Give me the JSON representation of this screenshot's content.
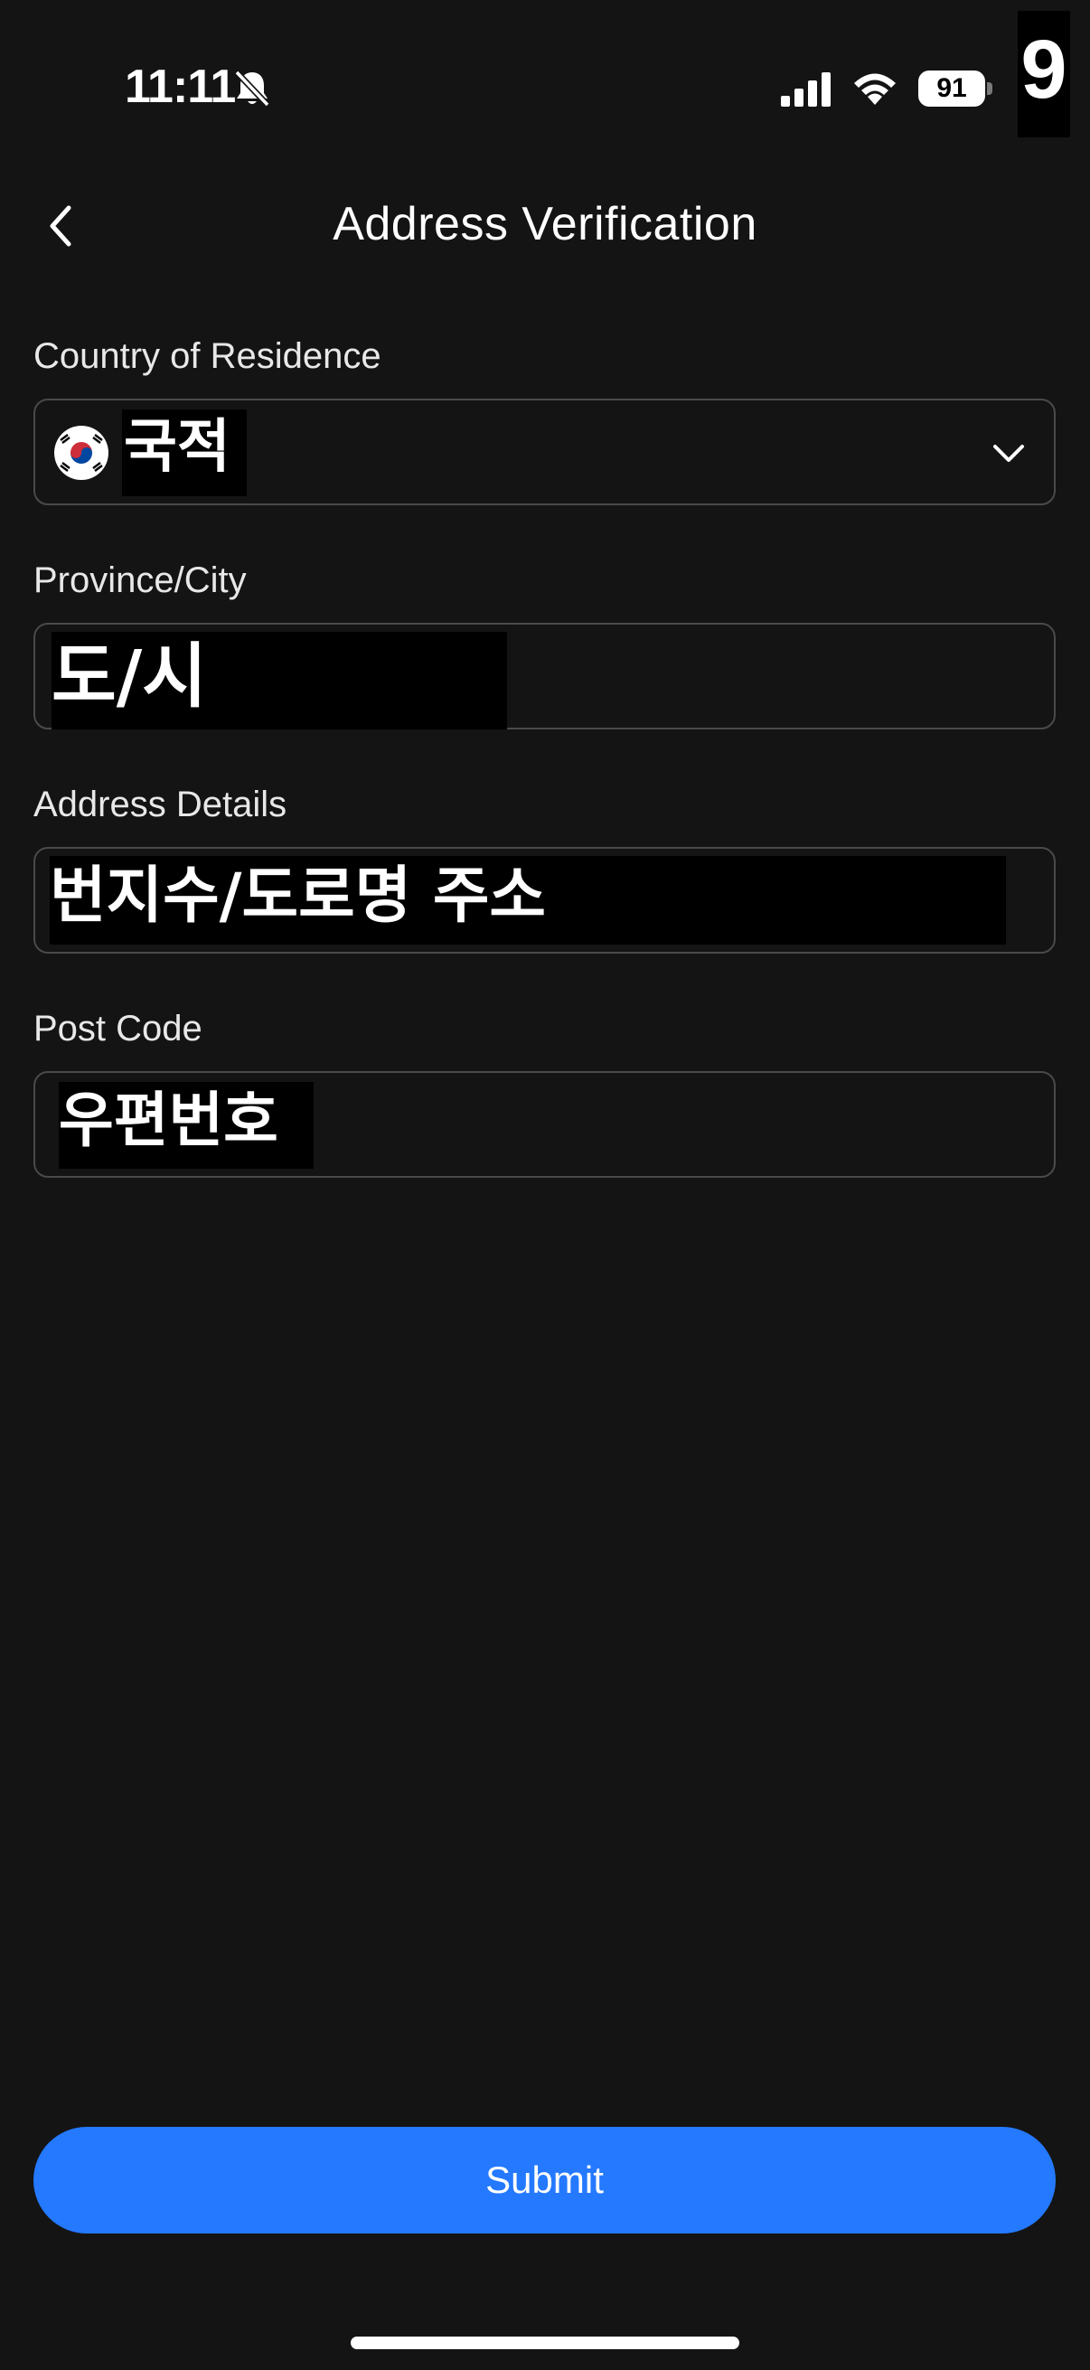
{
  "status_bar": {
    "time": "11:11",
    "battery": "91",
    "corner_badge": "9"
  },
  "header": {
    "title": "Address Verification"
  },
  "form": {
    "country": {
      "label": "Country of Residence",
      "value": "국적",
      "flag_icon": "south-korea-flag-icon"
    },
    "province": {
      "label": "Province/City",
      "value": "도/시"
    },
    "address": {
      "label": "Address Details",
      "value": "번지수/도로명 주소"
    },
    "post_code": {
      "label": "Post Code",
      "value": "우편번호"
    }
  },
  "submit_label": "Submit",
  "colors": {
    "background": "#141414",
    "accent": "#2479ff",
    "border": "#4a4a4a"
  }
}
